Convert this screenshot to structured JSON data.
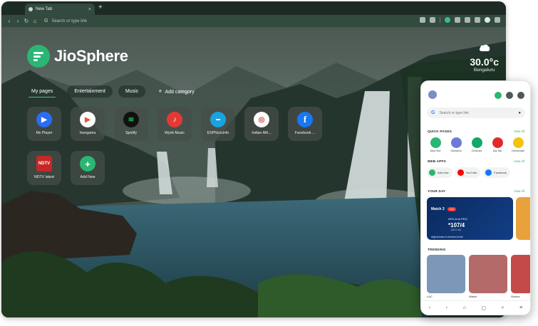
{
  "browser": {
    "tab_title": "New Tab",
    "tab_close": "×",
    "new_tab": "+",
    "omnibox_placeholder": "Search or type link"
  },
  "home": {
    "brand": "JioSphere",
    "weather": {
      "temp": "30.0°c",
      "city": "Bengaluru"
    },
    "categories": [
      "My pages",
      "Entertainment",
      "Music",
      "Add category"
    ],
    "tiles": [
      {
        "label": "Mx Player",
        "color": "#2a6df4",
        "glyph": "▶"
      },
      {
        "label": "Hungama",
        "color": "#ffffff",
        "glyph": "▶"
      },
      {
        "label": "Spotify",
        "color": "#1db954",
        "glyph": "≋"
      },
      {
        "label": "Wynk Music",
        "color": "#e53935",
        "glyph": "♪"
      },
      {
        "label": "ESPNcricinfo",
        "color": "#1aa2e0",
        "glyph": "▬"
      },
      {
        "label": "Indian Ath...",
        "color": "#ffffff",
        "glyph": "◎"
      },
      {
        "label": "Facebook ...",
        "color": "#1877f2",
        "glyph": "f"
      },
      {
        "label": "NDTV latest",
        "color": "#c62828",
        "glyph": "N"
      },
      {
        "label": "Add New",
        "color": "#2bb673",
        "glyph": "+"
      }
    ]
  },
  "phone": {
    "search_placeholder": "Search or type link",
    "quick_pages": {
      "title": "QUICK PAGES",
      "view_all": "View All",
      "items": [
        {
          "label": "Add new",
          "color": "#2bb673"
        },
        {
          "label": "Olympics",
          "color": "#6c7ad8"
        },
        {
          "label": "Cricbuzz",
          "color": "#12a86b"
        },
        {
          "label": "Aaj Tak",
          "color": "#e02b2b"
        },
        {
          "label": "Horoscope",
          "color": "#f2c40c"
        }
      ]
    },
    "web_apps": {
      "title": "WEB APPS",
      "view_all": "View All",
      "items": [
        {
          "label": "Add new",
          "color": "#2bb673"
        },
        {
          "label": "YouTube",
          "color": "#ff0000"
        },
        {
          "label": "Facebook",
          "color": "#1877f2"
        }
      ]
    },
    "your_day": {
      "title": "YOUR DAY",
      "view_all": "View All",
      "match": "Match 3",
      "live": "Live",
      "team_a": "AFG-A",
      "team_b": "PKG",
      "score": "*107/4",
      "overs": "(15.1 ov)",
      "news": "Afghanistan A elected to bat"
    },
    "trending": {
      "title": "TRENDING",
      "items": [
        {
          "label": "LAC",
          "color": "#7c97b8"
        },
        {
          "label": "Watch",
          "color": "#b56a6a"
        },
        {
          "label": "Stories",
          "color": "#c44a4a"
        }
      ]
    }
  }
}
